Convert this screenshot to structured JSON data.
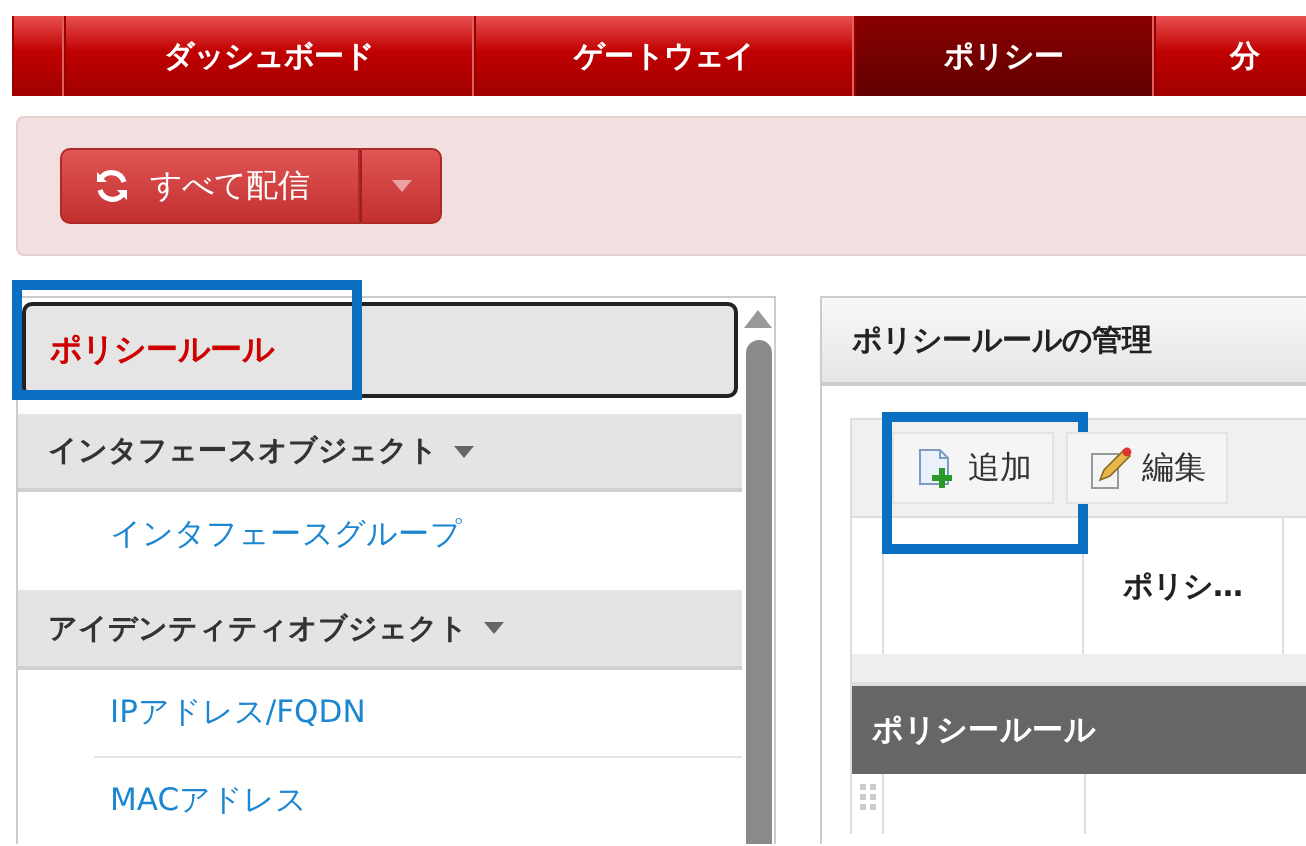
{
  "nav_tabs": [
    {
      "selected": false
    },
    {
      "label": "ダッシュボード",
      "selected": false
    },
    {
      "label": "ゲートウェイ",
      "selected": false
    },
    {
      "label": "ポリシー",
      "selected": true
    },
    {
      "label": "分",
      "selected": false
    }
  ],
  "toolbar": {
    "deploy_button": "すべて配信"
  },
  "sidebar": {
    "items": [
      {
        "kind": "item",
        "label": "ポリシールール",
        "selected": true,
        "highlighted": true
      },
      {
        "kind": "group",
        "label": "インタフェースオブジェクト",
        "expanded": true,
        "children": [
          {
            "label": "インタフェースグループ"
          }
        ]
      },
      {
        "kind": "group",
        "label": "アイデンティティオブジェクト",
        "expanded": true,
        "children": [
          {
            "label": "IPアドレス/FQDN"
          },
          {
            "label": "MACアドレス"
          }
        ]
      }
    ]
  },
  "main": {
    "title": "ポリシールールの管理",
    "actions": [
      {
        "kind": "add",
        "label": "追加",
        "highlighted": true
      },
      {
        "kind": "edit",
        "label": "編集",
        "highlighted": false
      }
    ],
    "table": {
      "columns": [
        {
          "kind": "handle"
        },
        {
          "kind": "blank"
        },
        {
          "kind": "text",
          "label": "ポリシ…"
        }
      ],
      "groups": [
        {
          "label": "ポリシールール"
        }
      ]
    }
  }
}
